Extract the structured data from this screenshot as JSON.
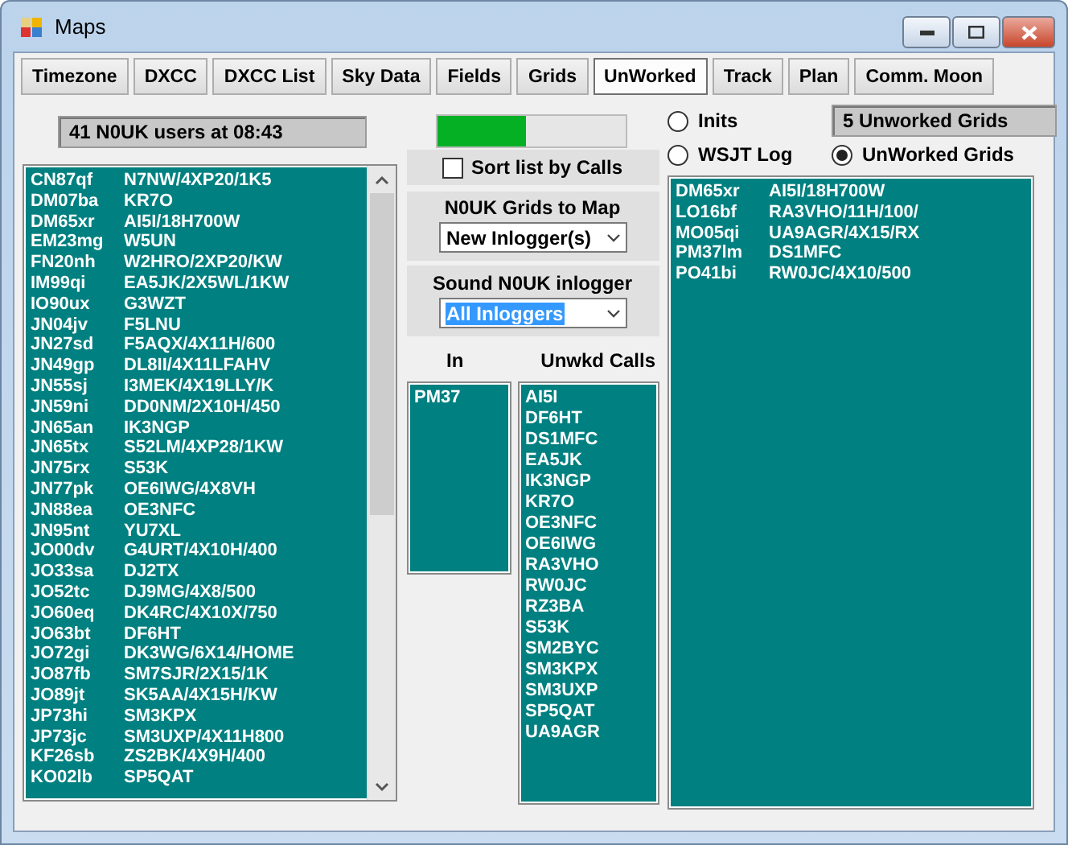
{
  "window": {
    "title": "Maps"
  },
  "tabs": [
    {
      "label": "Timezone",
      "selected": false
    },
    {
      "label": "DXCC",
      "selected": false
    },
    {
      "label": "DXCC List",
      "selected": false
    },
    {
      "label": "Sky Data",
      "selected": false
    },
    {
      "label": "Fields",
      "selected": false
    },
    {
      "label": "Grids",
      "selected": false
    },
    {
      "label": "UnWorked",
      "selected": true
    },
    {
      "label": "Track",
      "selected": false
    },
    {
      "label": "Plan",
      "selected": false
    },
    {
      "label": "Comm. Moon",
      "selected": false
    }
  ],
  "users_status": "41  N0UK users at  08:43",
  "users_list": [
    {
      "grid": "CN87qf",
      "calls": "N7NW/4XP20/1K5"
    },
    {
      "grid": "DM07ba",
      "calls": "KR7O"
    },
    {
      "grid": "DM65xr",
      "calls": "AI5I/18H700W"
    },
    {
      "grid": "EM23mg",
      "calls": "W5UN"
    },
    {
      "grid": "FN20nh",
      "calls": "W2HRO/2XP20/KW"
    },
    {
      "grid": "IM99qi",
      "calls": "EA5JK/2X5WL/1KW"
    },
    {
      "grid": "IO90ux",
      "calls": "G3WZT"
    },
    {
      "grid": "JN04jv",
      "calls": "F5LNU"
    },
    {
      "grid": "JN27sd",
      "calls": "F5AQX/4X11H/600"
    },
    {
      "grid": "JN49gp",
      "calls": "DL8II/4X11LFAHV"
    },
    {
      "grid": "JN55sj",
      "calls": "I3MEK/4X19LLY/K"
    },
    {
      "grid": "JN59ni",
      "calls": "DD0NM/2X10H/450"
    },
    {
      "grid": "JN65an",
      "calls": "IK3NGP"
    },
    {
      "grid": "JN65tx",
      "calls": "S52LM/4XP28/1KW"
    },
    {
      "grid": "JN75rx",
      "calls": "S53K"
    },
    {
      "grid": "JN77pk",
      "calls": "OE6IWG/4X8VH"
    },
    {
      "grid": "JN88ea",
      "calls": "OE3NFC"
    },
    {
      "grid": "JN95nt",
      "calls": "YU7XL"
    },
    {
      "grid": "JO00dv",
      "calls": "G4URT/4X10H/400"
    },
    {
      "grid": "JO33sa",
      "calls": "DJ2TX"
    },
    {
      "grid": "JO52tc",
      "calls": "DJ9MG/4X8/500"
    },
    {
      "grid": "JO60eq",
      "calls": "DK4RC/4X10X/750"
    },
    {
      "grid": "JO63bt",
      "calls": "DF6HT"
    },
    {
      "grid": "JO72gi",
      "calls": "DK3WG/6X14/HOME"
    },
    {
      "grid": "JO87fb",
      "calls": "SM7SJR/2X15/1K"
    },
    {
      "grid": "JO89jt",
      "calls": "SK5AA/4X15H/KW"
    },
    {
      "grid": "JP73hi",
      "calls": "SM3KPX"
    },
    {
      "grid": "JP73jc",
      "calls": "SM3UXP/4X11H800"
    },
    {
      "grid": "KF26sb",
      "calls": "ZS2BK/4X9H/400"
    },
    {
      "grid": "KO02lb",
      "calls": "SP5QAT"
    }
  ],
  "progress": {
    "level": 0.47
  },
  "sort_checkbox": {
    "label": "Sort list by Calls",
    "checked": false
  },
  "grids_to_map": {
    "label": "N0UK  Grids to Map",
    "value": "New Inlogger(s)"
  },
  "sound_inlogger": {
    "label": "Sound N0UK inlogger",
    "value": "All Inloggers"
  },
  "in_header": "In",
  "unworked_header": "Unwkd  Calls",
  "in_list": [
    "PM37"
  ],
  "unworked_calls": [
    "AI5I",
    "DF6HT",
    "DS1MFC",
    "EA5JK",
    "IK3NGP",
    "KR7O",
    "OE3NFC",
    "OE6IWG",
    "RA3VHO",
    "RW0JC",
    "RZ3BA",
    "S53K",
    "SM2BYC",
    "SM3KPX",
    "SM3UXP",
    "SP5QAT",
    "UA9AGR"
  ],
  "radios": [
    {
      "label": "Inits",
      "selected": false
    },
    {
      "label": "WSJT Log",
      "selected": false
    },
    {
      "label": "UnWorked Grids",
      "selected": true
    }
  ],
  "unworked_grids_count": "5  Unworked Grids",
  "unworked_grids": [
    {
      "grid": "DM65xr",
      "calls": "AI5I/18H700W"
    },
    {
      "grid": "LO16bf",
      "calls": "RA3VHO/11H/100/"
    },
    {
      "grid": "MO05qi",
      "calls": "UA9AGR/4X15/RX"
    },
    {
      "grid": "PM37lm",
      "calls": "DS1MFC"
    },
    {
      "grid": "PO41bi",
      "calls": "RW0JC/4X10/500"
    }
  ]
}
